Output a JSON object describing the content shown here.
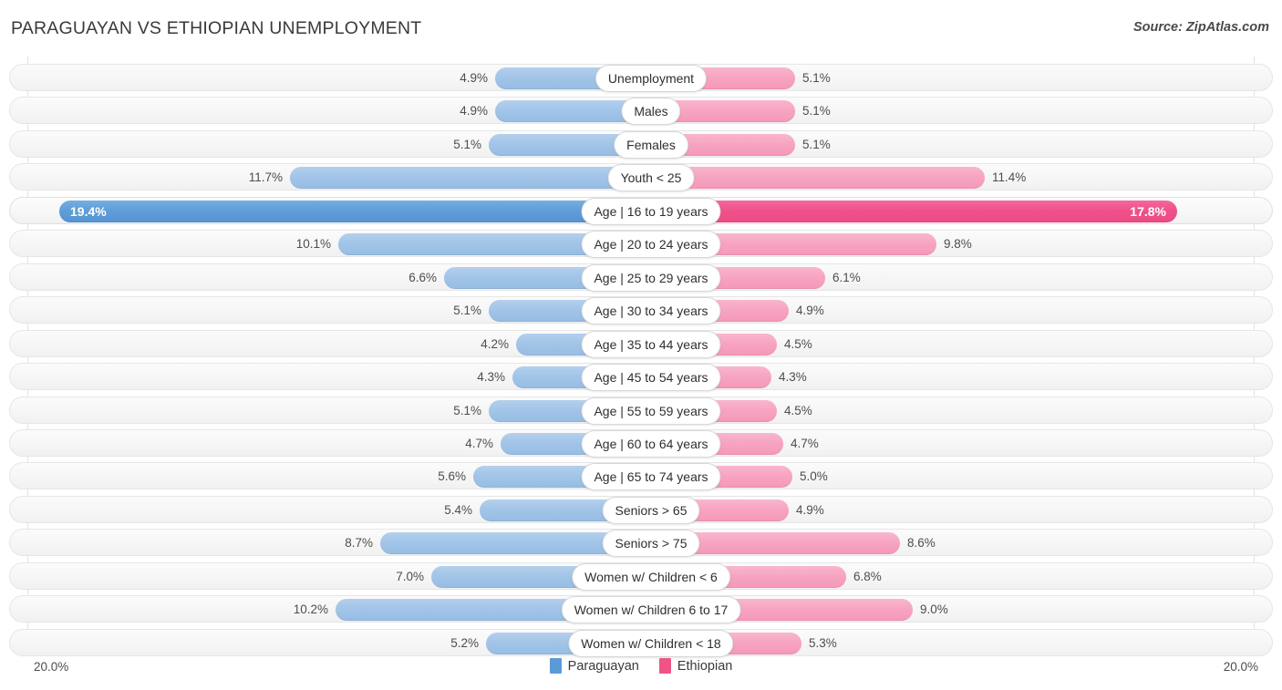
{
  "header": {
    "title": "PARAGUAYAN VS ETHIOPIAN UNEMPLOYMENT",
    "source": "Source: ZipAtlas.com"
  },
  "axis": {
    "min_label": "20.0%",
    "max_label": "20.0%",
    "max_value": 20.0
  },
  "legend": {
    "items": [
      {
        "label": "Paraguayan",
        "color": "#5b9bd5"
      },
      {
        "label": "Ethiopian",
        "color": "#ee5586"
      }
    ]
  },
  "colors": {
    "left_normal": "#a2c5e8",
    "left_highlight": "#5f9ed8",
    "right_normal": "#f7a4c2",
    "right_highlight": "#f0518a",
    "row_bg": "#f6f6f6",
    "gridline": "#e2e2e2",
    "text": "#4d4d4d"
  },
  "chart_data": {
    "type": "bar",
    "title": "PARAGUAYAN VS ETHIOPIAN UNEMPLOYMENT",
    "subtitle": "Source: ZipAtlas.com",
    "orientation": "horizontal-diverging",
    "xlabel": "",
    "ylabel": "",
    "xlim": [
      -20.0,
      20.0
    ],
    "axis_tick_labels": [
      "20.0%",
      "20.0%"
    ],
    "grid": true,
    "legend_position": "bottom-center",
    "categories": [
      "Unemployment",
      "Males",
      "Females",
      "Youth < 25",
      "Age | 16 to 19 years",
      "Age | 20 to 24 years",
      "Age | 25 to 29 years",
      "Age | 30 to 34 years",
      "Age | 35 to 44 years",
      "Age | 45 to 54 years",
      "Age | 55 to 59 years",
      "Age | 60 to 64 years",
      "Age | 65 to 74 years",
      "Seniors > 65",
      "Seniors > 75",
      "Women w/ Children < 6",
      "Women w/ Children 6 to 17",
      "Women w/ Children < 18"
    ],
    "series": [
      {
        "name": "Paraguayan",
        "color": "#5b9bd5",
        "side": "left",
        "values": [
          4.9,
          4.9,
          5.1,
          11.7,
          19.4,
          10.1,
          6.6,
          5.1,
          4.2,
          4.3,
          5.1,
          4.7,
          5.6,
          5.4,
          8.7,
          7.0,
          10.2,
          5.2
        ],
        "labels": [
          "4.9%",
          "4.9%",
          "5.1%",
          "11.7%",
          "19.4%",
          "10.1%",
          "6.6%",
          "5.1%",
          "4.2%",
          "4.3%",
          "5.1%",
          "4.7%",
          "5.6%",
          "5.4%",
          "8.7%",
          "7.0%",
          "10.2%",
          "5.2%"
        ]
      },
      {
        "name": "Ethiopian",
        "color": "#ee5586",
        "side": "right",
        "values": [
          5.1,
          5.1,
          5.1,
          11.4,
          17.8,
          9.8,
          6.1,
          4.9,
          4.5,
          4.3,
          4.5,
          4.7,
          5.0,
          4.9,
          8.6,
          6.8,
          9.0,
          5.3
        ],
        "labels": [
          "5.1%",
          "5.1%",
          "5.1%",
          "11.4%",
          "17.8%",
          "9.8%",
          "6.1%",
          "4.9%",
          "4.5%",
          "4.3%",
          "4.5%",
          "4.7%",
          "5.0%",
          "4.9%",
          "8.6%",
          "6.8%",
          "9.0%",
          "5.3%"
        ]
      }
    ],
    "highlighted_row_index": 4
  }
}
